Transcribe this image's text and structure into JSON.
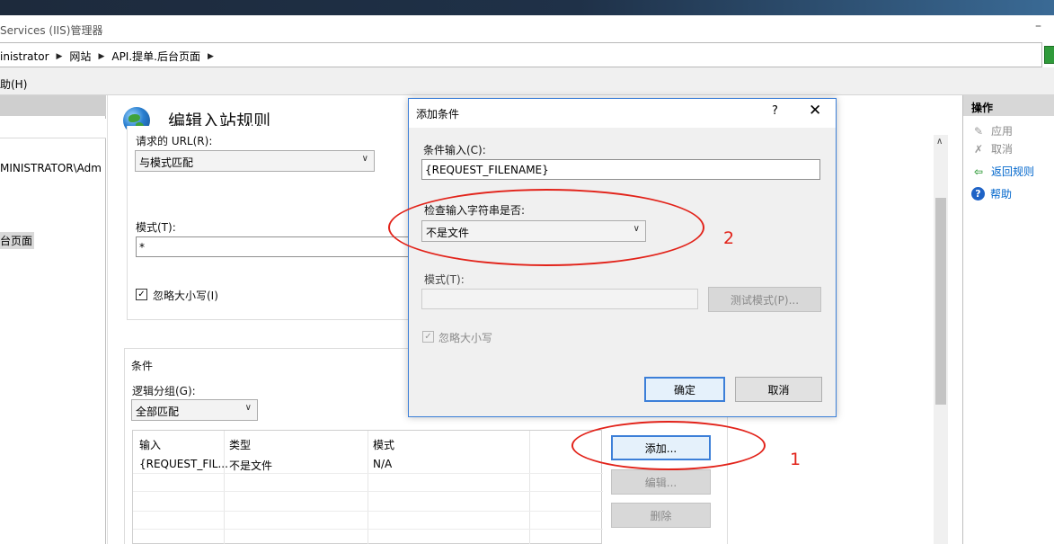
{
  "window": {
    "title": "Services (IIS)管理器",
    "minimize_glyph": "–"
  },
  "address_bar": {
    "crumbs": [
      "inistrator",
      "网站",
      "API.提单.后台页面"
    ]
  },
  "menubar": {
    "help_label": "助(H)"
  },
  "left_tree": {
    "node_admin": "MINISTRATOR\\Adm",
    "node_site": "台页面"
  },
  "rule_editor": {
    "title": "编辑入站规则",
    "requested_url_label": "请求的 URL(R):",
    "requested_url_value": "与模式匹配",
    "pattern_label": "模式(T):",
    "pattern_value": "*",
    "ignore_case_label": "忽略大小写(I)",
    "conditions_group_label": "条件",
    "logical_grouping_label": "逻辑分组(G):",
    "logical_grouping_value": "全部匹配",
    "table": {
      "headers": [
        "输入",
        "类型",
        "模式"
      ],
      "rows": [
        [
          "{REQUEST_FIL...",
          "不是文件",
          "N/A"
        ]
      ]
    },
    "buttons": {
      "add": "添加...",
      "edit": "编辑...",
      "delete": "删除"
    }
  },
  "actions": {
    "header": "操作",
    "items": [
      {
        "label": "应用",
        "icon": "apply-icon",
        "enabled": false
      },
      {
        "label": "取消",
        "icon": "cancel-icon",
        "enabled": false
      },
      {
        "label": "返回规则",
        "icon": "back-arrow-icon",
        "enabled": true
      },
      {
        "label": "帮助",
        "icon": "help-icon",
        "enabled": true
      }
    ]
  },
  "add_condition_dialog": {
    "title": "添加条件",
    "help_glyph": "?",
    "close_glyph": "✕",
    "condition_input_label": "条件输入(C):",
    "condition_input_value": "{REQUEST_FILENAME}",
    "check_label": "检查输入字符串是否:",
    "check_value": "不是文件",
    "pattern_label": "模式(T):",
    "pattern_value": "",
    "test_pattern_button": "测试模式(P)...",
    "ignore_case_label": "忽略大小写",
    "ok_button": "确定",
    "cancel_button": "取消"
  },
  "annotations": {
    "marker_1": "1",
    "marker_2": "2"
  },
  "colors": {
    "annotation_red": "#e2231a",
    "focus_blue": "#3c7fd8",
    "link_blue": "#0066cc"
  }
}
